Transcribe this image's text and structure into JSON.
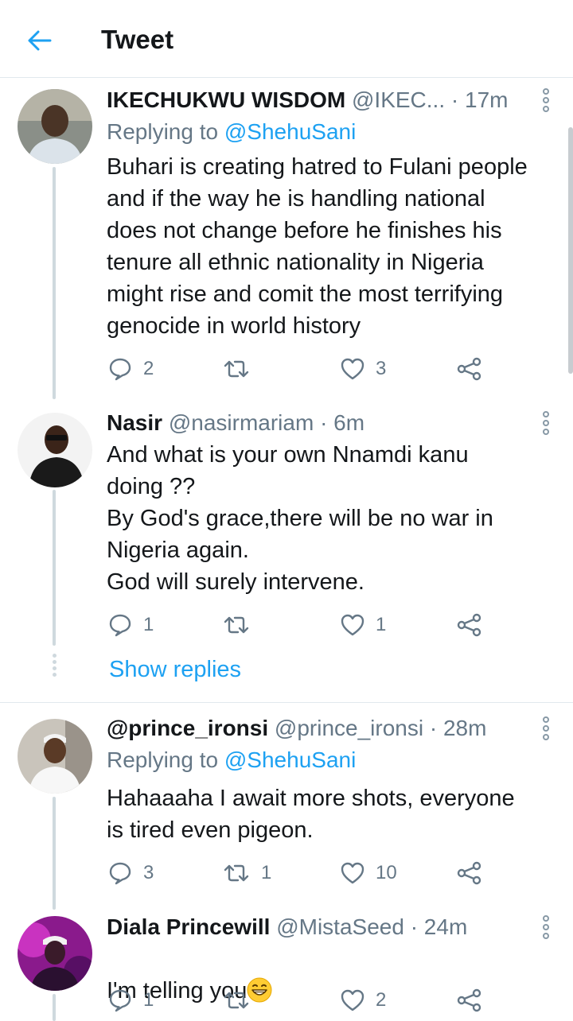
{
  "header": {
    "title": "Tweet"
  },
  "tweets": [
    {
      "name": "IKECHUKWU WISDOM",
      "handle": "@IKEC...",
      "time": "· 17m",
      "replying_label": "Replying to",
      "replying_to": "@ShehuSani",
      "text": "Buhari is creating hatred to Fulani people\nand if the way he is handling national\ndoes not change before he finishes his\ntenure all ethnic nationality in Nigeria\nmight rise and comit the most terrifying\ngenocide in world history",
      "replies": "2",
      "retweets": "",
      "likes": "3"
    },
    {
      "name": "Nasir",
      "handle": "@nasirmariam",
      "time": "· 6m",
      "text": "And what is your own Nnamdi kanu\ndoing ??\nBy God's grace,there will be no war in\nNigeria again.\nGod will surely intervene.",
      "replies": "1",
      "retweets": "",
      "likes": "1",
      "show_replies": "Show replies"
    },
    {
      "name": "@prince_ironsi",
      "handle": "@prince_ironsi",
      "time": "· 28m",
      "replying_label": "Replying to",
      "replying_to": "@ShehuSani",
      "text": "Hahaaaha I await more shots, everyone\nis tired even pigeon.",
      "replies": "3",
      "retweets": "1",
      "likes": "10"
    },
    {
      "name": "Diala Princewill",
      "handle": "@MistaSeed",
      "time": "· 24m",
      "text": "I'm telling you",
      "emoji": "grinning-face-emoji",
      "replies": "1",
      "retweets": "",
      "likes": "2"
    }
  ],
  "icons": {
    "back": "arrow-left-icon",
    "reply": "speech-bubble-icon",
    "retweet": "retweet-icon",
    "like": "heart-icon",
    "share": "share-icon",
    "more": "more-vertical-icon"
  },
  "colors": {
    "accent": "#1da1f2",
    "muted": "#657786",
    "text": "#14171a",
    "divider": "#e1e8ed"
  }
}
